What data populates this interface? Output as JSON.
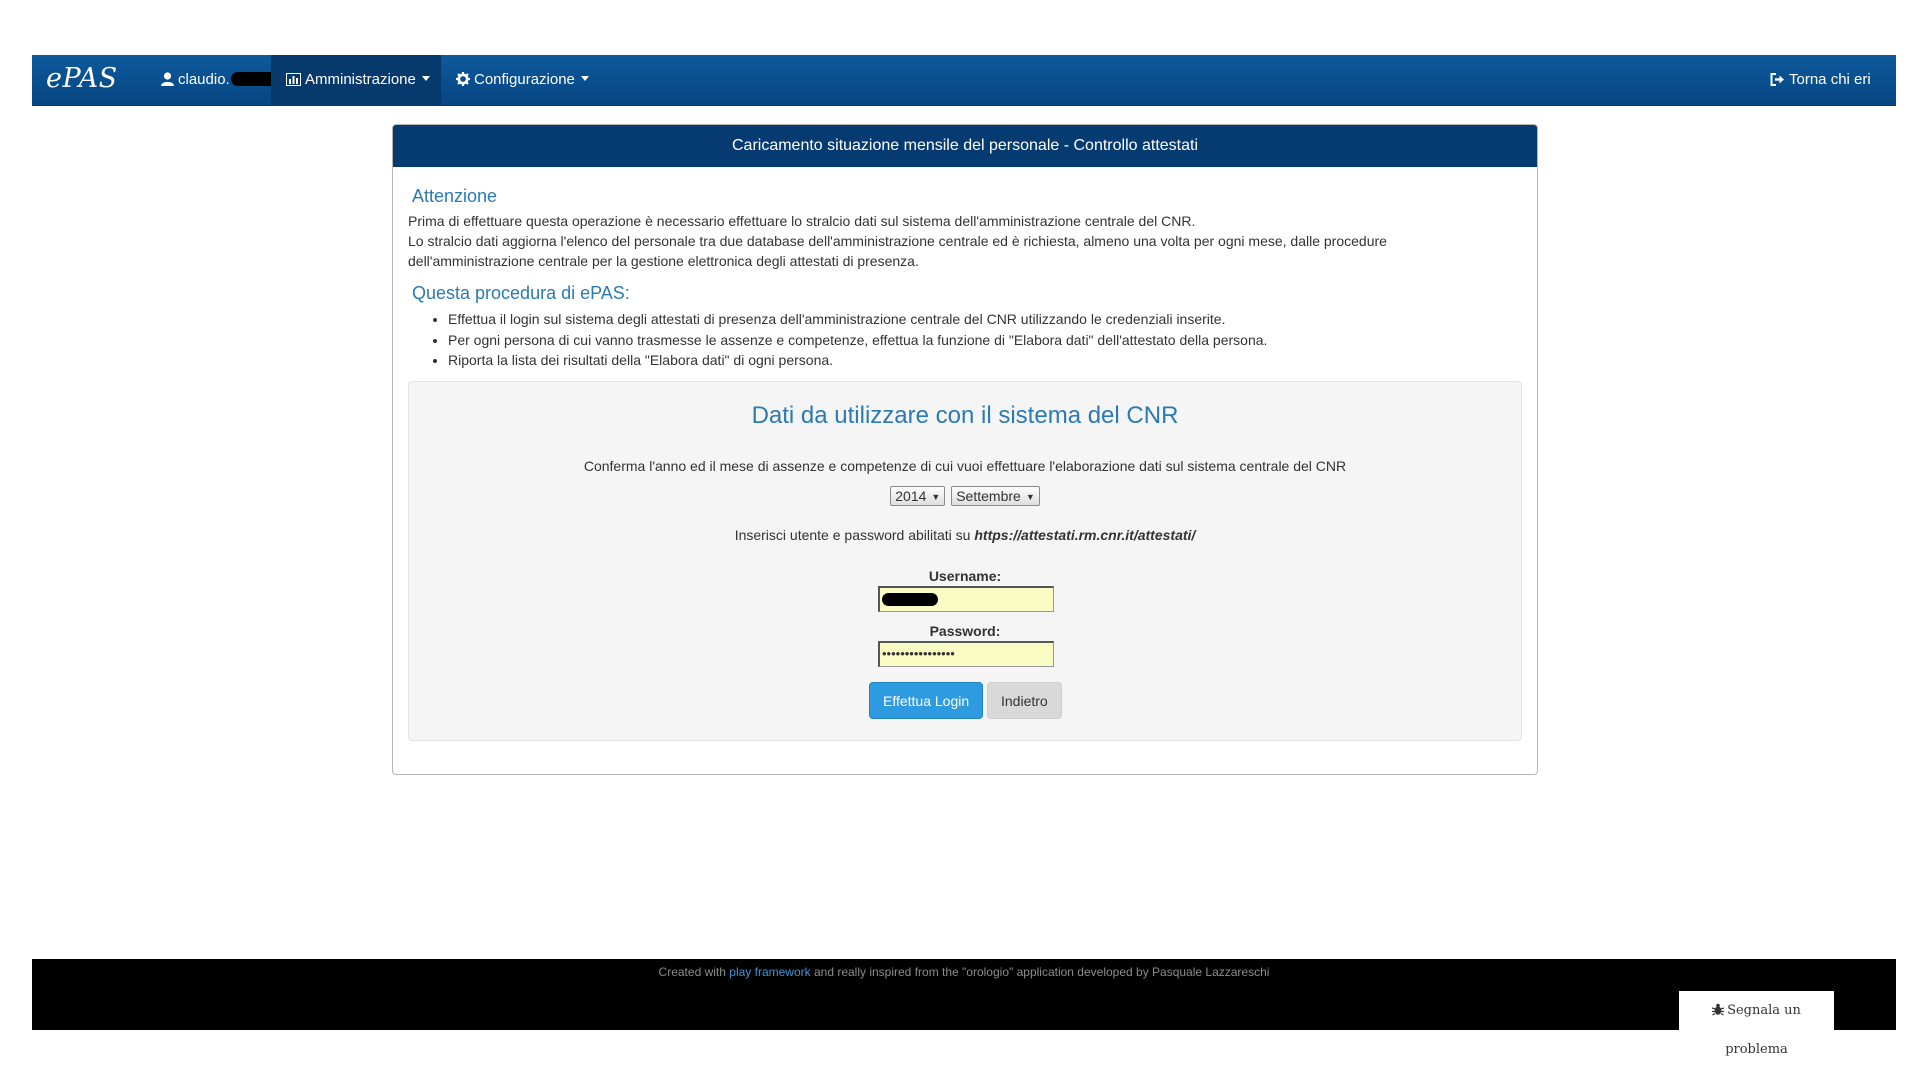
{
  "nav": {
    "brand": "ePAS",
    "user": "claudio.",
    "admin": "Amministrazione",
    "config": "Configurazione",
    "back": "Torna chi eri",
    "icons": [
      "user-icon",
      "bar-chart-icon",
      "gear-icon",
      "sign-out-icon"
    ]
  },
  "panel": {
    "heading": "Caricamento situazione mensile del personale - Controllo attestati",
    "attention_title": "Attenzione",
    "attention_lines": [
      "Prima di effettuare questa operazione è necessario effettuare lo stralcio dati sul sistema dell'amministrazione centrale del CNR.",
      "Lo stralcio dati aggiorna l'elenco del personale tra due database dell'amministrazione centrale ed è richiesta, almeno una volta per ogni mese, dalle procedure",
      "dell'amministrazione centrale per la gestione elettronica degli attestati di presenza."
    ],
    "procedure_title": "Questa procedura di ePAS:",
    "procedure_items": [
      "Effettua il login sul sistema degli attestati di presenza dell'amministrazione centrale del CNR utilizzando le credenziali inserite.",
      "Per ogni persona di cui vanno trasmesse le assenze e competenze, effettua la funzione di \"Elabora dati\" dell'attestato della persona.",
      "Riporta la lista dei risultati della \"Elabora dati\" di ogni persona."
    ]
  },
  "form": {
    "title": "Dati da utilizzare con il sistema del CNR",
    "confirm_text": "Conferma l'anno ed il mese di assenze e competenze di cui vuoi effettuare l'elaborazione dati sul sistema centrale del CNR",
    "year": "2014",
    "month": "Settembre",
    "insert_text": "Inserisci utente e password abilitati su",
    "url": "https://attestati.rm.cnr.it/attestati/",
    "username_label": "Username:",
    "password_label": "Password:",
    "password_mask": "••••••••••••••••",
    "login_button": "Effettua Login",
    "back_button": "Indietro"
  },
  "footer": {
    "prefix": "Created with",
    "link": "play framework",
    "suffix": "and really inspired from the \"orologio\" application developed by Pasquale Lazzareschi",
    "report": "Segnala un problema"
  },
  "colors": {
    "navbar": "#064582",
    "heading": "#063b72",
    "accent": "#2a7ab4",
    "primary_button": "#2e9be0",
    "input_bg": "#fafdc3"
  }
}
